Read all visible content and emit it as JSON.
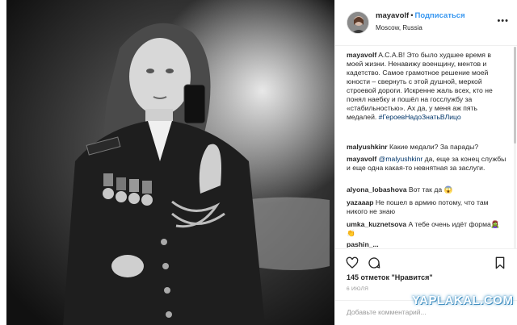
{
  "post": {
    "username": "mayavolf",
    "separator": "•",
    "follow_label": "Подписаться",
    "location": "Moscow, Russia",
    "more_label": "•••"
  },
  "comments": [
    {
      "user": "mayavolf",
      "text": "A.C.A.B! Это было худшее время в моей жизни. Ненавижу военщину, ментов и кадетство. Самое грамотное решение моей юности – свернуть с этой душной, меркой строевой дороги. Искренне жаль всех, кто не понял наебку и пошёл на госслужбу за «стабильностью». Ах да, у меня аж пять медалей.",
      "hashtag": "#ГероевНадоЗнатьВЛицо"
    },
    {
      "user": "malyushkinr",
      "text": "Какие медали? За парады?"
    },
    {
      "user": "mayavolf",
      "mention": "@malyushkinr",
      "text": "да, еще за конец службы и еще одна какая-то невнятная за заслуги."
    },
    {
      "user": "alyona_lobashova",
      "text": "Вот так да 😱"
    },
    {
      "user": "yazaaap",
      "text": "Не пошел в армию потому, что там никого не знаю"
    },
    {
      "user": "umka_kuznetsova",
      "text": "А тебе очень идёт форма🧟‍♀️👏"
    },
    {
      "user": "pashin_...",
      "text": ""
    }
  ],
  "likes_label": "145 отметок \"Нравится\"",
  "date_label": "6 ИЮЛЯ",
  "add_comment_placeholder": "Добавьте комментарий...",
  "watermark": "YAPLAKAL.COM",
  "icons": [
    "heart-icon",
    "comment-icon",
    "bookmark-icon",
    "more-options-icon"
  ],
  "colors": {
    "accent": "#3897f0",
    "text": "#262626",
    "muted": "#999999",
    "border": "#efefef"
  }
}
